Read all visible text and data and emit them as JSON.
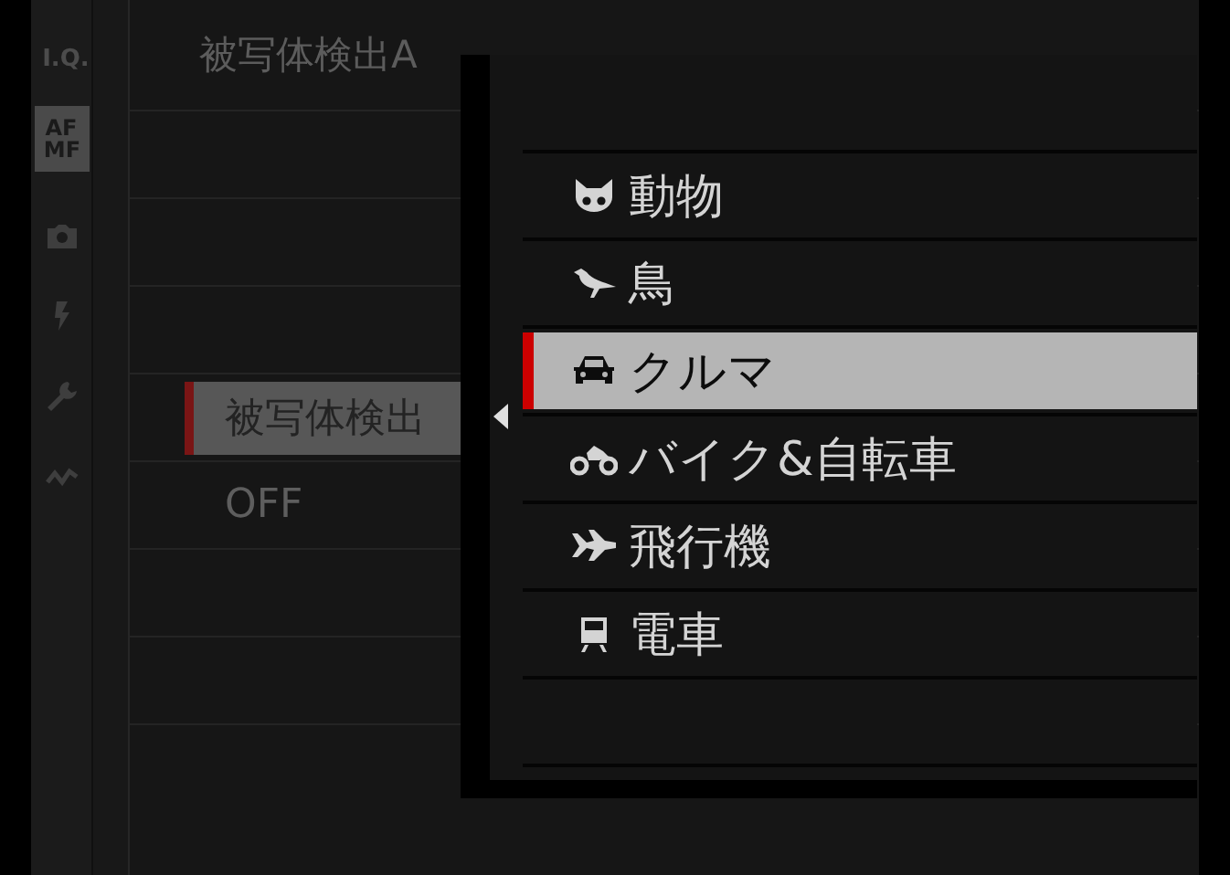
{
  "sidebar": {
    "tabs": [
      {
        "label": "I.Q.",
        "selected": false
      },
      {
        "label": "AF MF",
        "selected": true
      }
    ]
  },
  "menu": {
    "title": "被写体検出A",
    "items": [
      {
        "label": "被写体検出",
        "selected": true
      },
      {
        "label": "OFF",
        "selected": false
      }
    ]
  },
  "popup": {
    "items": [
      {
        "label": "動物",
        "selected": false
      },
      {
        "label": "鳥",
        "selected": false
      },
      {
        "label": "クルマ",
        "selected": true
      },
      {
        "label": "バイク&自転車",
        "selected": false
      },
      {
        "label": "飛行機",
        "selected": false
      },
      {
        "label": "電車",
        "selected": false
      }
    ]
  }
}
